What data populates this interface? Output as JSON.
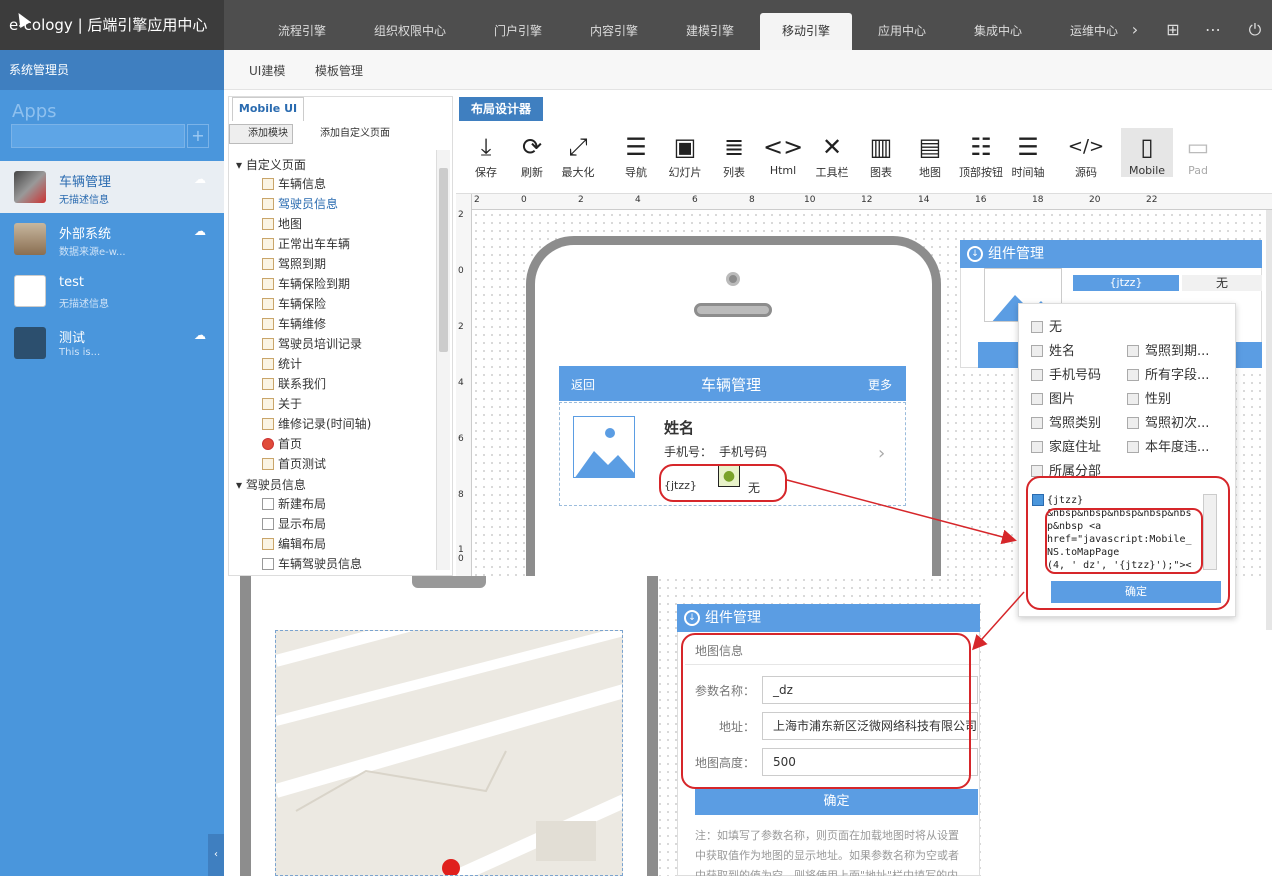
{
  "header": {
    "brand": "e-cology | 后端引擎应用中心",
    "tabs": [
      {
        "label": "流程引擎"
      },
      {
        "label": "组织权限中心"
      },
      {
        "label": "门户引擎"
      },
      {
        "label": "内容引擎"
      },
      {
        "label": "建模引擎"
      },
      {
        "label": "移动引擎"
      },
      {
        "label": "应用中心"
      },
      {
        "label": "集成中心"
      },
      {
        "label": "运维中心"
      }
    ],
    "active_tab": "移动引擎"
  },
  "sidebar": {
    "user": "系统管理员",
    "apps_label": "Apps",
    "apps": [
      {
        "title": "车辆管理",
        "desc": "无描述信息"
      },
      {
        "title": "外部系统",
        "desc": "数据来源e-w..."
      },
      {
        "title": "test",
        "desc": "无描述信息"
      },
      {
        "title": "测试",
        "desc": "This is..."
      }
    ]
  },
  "subnav": {
    "items": [
      "UI建模",
      "模板管理"
    ]
  },
  "left_panel": {
    "tab": "Mobile UI",
    "add_module": "添加模块",
    "add_custom_page": "添加自定义页面",
    "groups": [
      {
        "label": "自定义页面",
        "items": [
          "车辆信息",
          "驾驶员信息",
          "地图",
          "正常出车车辆",
          "驾照到期",
          "车辆保险到期",
          "车辆保险",
          "车辆维修",
          "驾驶员培训记录",
          "统计",
          "联系我们",
          "关于",
          "维修记录(时间轴)",
          "首页",
          "首页测试"
        ]
      },
      {
        "label": "驾驶员信息",
        "items": [
          "新建布局",
          "显示布局",
          "编辑布局",
          "车辆驾驶员信息"
        ]
      }
    ],
    "selected_item": "驾驶员信息"
  },
  "designer": {
    "tab": "布局设计器",
    "tools": [
      "保存",
      "刷新",
      "最大化",
      "导航",
      "幻灯片",
      "列表",
      "Html",
      "工具栏",
      "图表",
      "地图",
      "顶部按钮",
      "时间轴",
      "源码",
      "Mobile",
      "Pad"
    ],
    "ruler_top": [
      "2",
      "0",
      "2",
      "4",
      "6",
      "8",
      "10",
      "12",
      "14",
      "16",
      "18",
      "20",
      "22"
    ],
    "ruler_left": [
      "2",
      "0",
      "2",
      "4",
      "6",
      "8",
      "1 0"
    ]
  },
  "mobile_preview": {
    "back": "返回",
    "title": "车辆管理",
    "more": "更多",
    "name": "姓名",
    "phone_label": "手机号：",
    "phone_value": "手机号码",
    "field_left": "{jtzz}",
    "field_right": "无"
  },
  "component_panel": {
    "title": "组件管理",
    "chip_left": "{jtzz}",
    "chip_right": "无",
    "options_left": [
      "无",
      "姓名",
      "手机号码",
      "图片",
      "驾照类别",
      "家庭住址",
      "所属分部"
    ],
    "options_right": [
      "驾照到期...",
      "所有字段...",
      "性别",
      "驾照初次...",
      "本年度违..."
    ],
    "code": "{jtzz}\n&nbsp&nbsp&nbsp&nbsp&nbs\np&nbsp <a\nhref=\"javascript:Mobile_\nNS.toMapPage\n(4, '_dz', '{jtzz}');\"><",
    "confirm": "确定"
  },
  "map_panel": {
    "title": "组件管理",
    "section": "地图信息",
    "param_label": "参数名称：",
    "param_value": "_dz",
    "addr_label": "地址：",
    "addr_value": "上海市浦东新区泛微网络科技有限公司",
    "height_label": "地图高度：",
    "height_value": "500",
    "confirm": "确定",
    "note": "注：如填写了参数名称，则页面在加载地图时将从设置\n中获取值作为地图的显示地址。如果参数名称为空或者\n中获取到的值为空，则将使用上面\"地址\"栏中填写的内"
  },
  "colors": {
    "accent": "#4a96dc",
    "header": "#4e4e4e",
    "highlight": "#d6262a"
  }
}
